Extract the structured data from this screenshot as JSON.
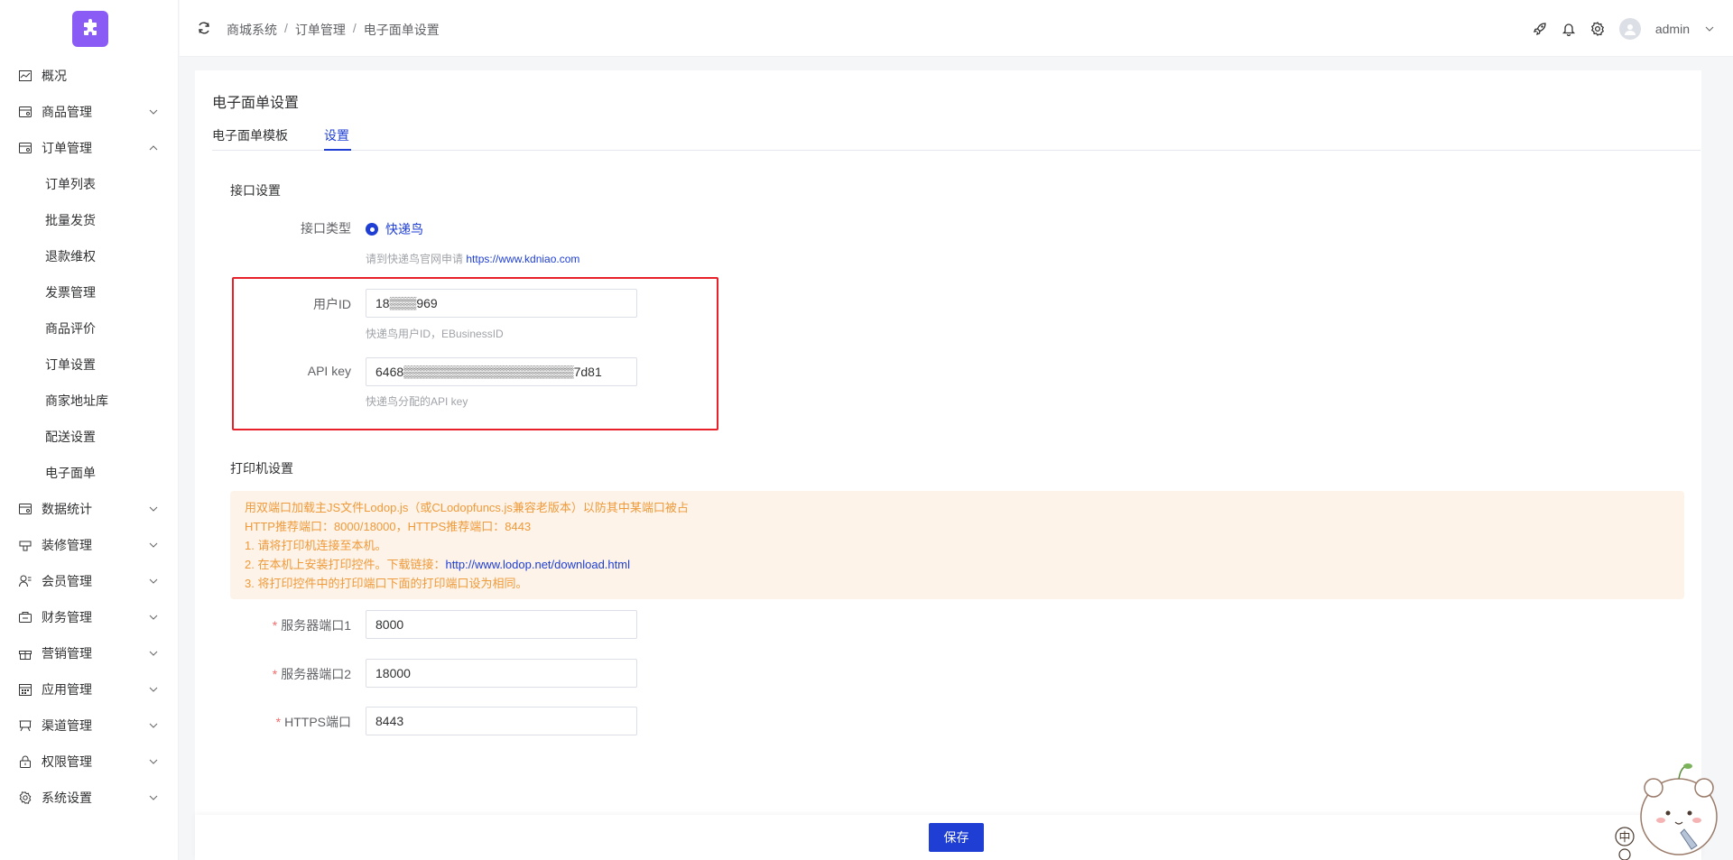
{
  "sidebar": {
    "items": [
      {
        "label": "概况",
        "icon": "chart-line-icon",
        "chevron": ""
      },
      {
        "label": "商品管理",
        "icon": "shop-icon",
        "chevron": "down"
      },
      {
        "label": "订单管理",
        "icon": "shop-icon",
        "chevron": "up"
      }
    ],
    "sub_items": [
      "订单列表",
      "批量发货",
      "退款维权",
      "发票管理",
      "商品评价",
      "订单设置",
      "商家地址库",
      "配送设置",
      "电子面单"
    ],
    "items_after": [
      {
        "label": "数据统计",
        "icon": "shop-icon",
        "chevron": "down"
      },
      {
        "label": "装修管理",
        "icon": "brush-icon",
        "chevron": "down"
      },
      {
        "label": "会员管理",
        "icon": "user-icon",
        "chevron": "down"
      },
      {
        "label": "财务管理",
        "icon": "wallet-icon",
        "chevron": "down"
      },
      {
        "label": "营销管理",
        "icon": "gift-icon",
        "chevron": "down"
      },
      {
        "label": "应用管理",
        "icon": "calendar-icon",
        "chevron": "down"
      },
      {
        "label": "渠道管理",
        "icon": "board-icon",
        "chevron": "down"
      },
      {
        "label": "权限管理",
        "icon": "lock-icon",
        "chevron": "down"
      },
      {
        "label": "系统设置",
        "icon": "gear-icon",
        "chevron": "down"
      }
    ]
  },
  "header": {
    "breadcrumb": [
      "商城系统",
      "订单管理",
      "电子面单设置"
    ],
    "breadcrumb_sep": "/",
    "user": "admin"
  },
  "card": {
    "title": "电子面单设置",
    "tabs": [
      "电子面单模板",
      "设置"
    ],
    "active_tab": "设置"
  },
  "api_section": {
    "title": "接口设置",
    "type_label": "接口类型",
    "type_option": "快递鸟",
    "type_hint": "请到快递鸟官网申请",
    "type_hint_link": "https://www.kdniao.com",
    "user_id_label": "用户ID",
    "user_id_value": "18▒▒▒969",
    "user_id_hint": "快递鸟用户ID，EBusinessID",
    "api_key_label": "API key",
    "api_key_value": "6468▒▒▒▒▒▒▒▒▒▒▒▒▒▒▒▒▒▒▒7d81",
    "api_key_hint": "快递鸟分配的API key"
  },
  "printer_section": {
    "title": "打印机设置",
    "notice": [
      "用双端口加载主JS文件Lodop.js（或CLodopfuncs.js兼容老版本）以防其中某端口被占",
      "HTTP推荐端口：8000/18000，HTTPS推荐端口：8443",
      "1. 请将打印机连接至本机。",
      "2. 在本机上安装打印控件。下载链接：",
      "3. 将打印控件中的打印端口下面的打印端口设为相同。"
    ],
    "download_link": "http://www.lodop.net/download.html",
    "port1_label": "服务器端口1",
    "port1_value": "8000",
    "port2_label": "服务器端口2",
    "port2_value": "18000",
    "https_label": "HTTPS端口",
    "https_value": "8443",
    "required_mark": "*"
  },
  "footer": {
    "save_label": "保存"
  },
  "mascot": {
    "badge": "中"
  },
  "colors": {
    "primary": "#1e3ed4",
    "highlight_border": "#e8202a",
    "notice_bg": "#fdf3e8",
    "notice_text": "#ef9a3a",
    "logo": "#8a5cf5"
  }
}
